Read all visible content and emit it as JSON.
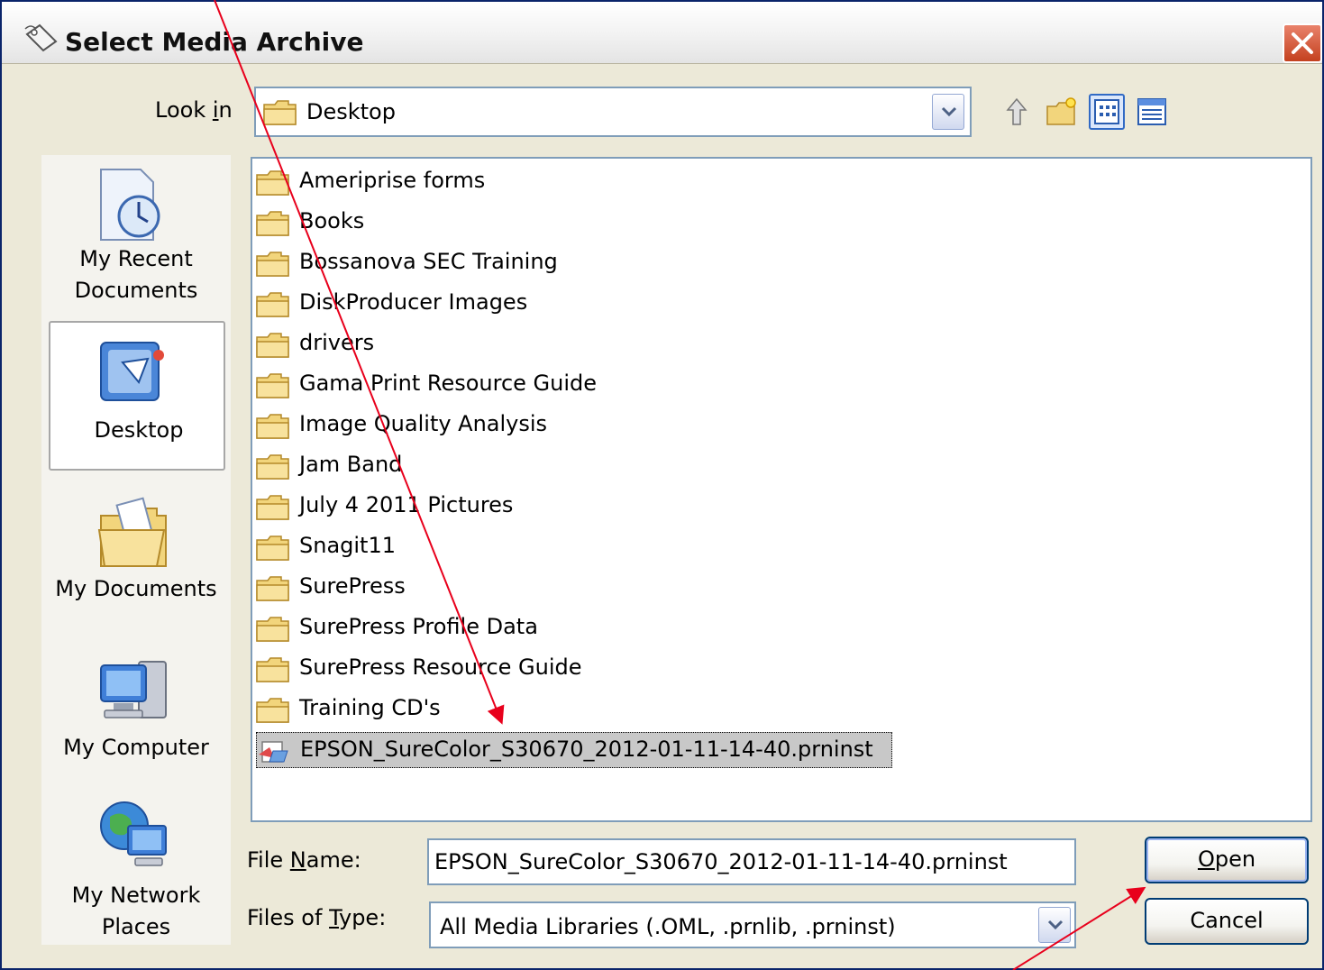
{
  "window": {
    "title": "Select Media Archive"
  },
  "look_in": {
    "label_pre": "Look ",
    "label_accel": "i",
    "label_post": "n",
    "value": "Desktop"
  },
  "places": [
    {
      "label_line1": "My Recent",
      "label_line2": "Documents",
      "icon": "recent-documents-icon"
    },
    {
      "label_line1": "Desktop",
      "label_line2": "",
      "icon": "desktop-icon"
    },
    {
      "label_line1": "My Documents",
      "label_line2": "",
      "icon": "my-documents-icon"
    },
    {
      "label_line1": "My Computer",
      "label_line2": "",
      "icon": "my-computer-icon"
    },
    {
      "label_line1": "My Network",
      "label_line2": "Places",
      "icon": "network-places-icon"
    }
  ],
  "files": [
    {
      "name": "Ameriprise forms",
      "type": "folder"
    },
    {
      "name": "Books",
      "type": "folder"
    },
    {
      "name": "Bossanova SEC Training",
      "type": "folder"
    },
    {
      "name": "DiskProducer Images",
      "type": "folder"
    },
    {
      "name": "drivers",
      "type": "folder"
    },
    {
      "name": "Gama Print Resource Guide",
      "type": "folder"
    },
    {
      "name": "Image Quality Analysis",
      "type": "folder"
    },
    {
      "name": "Jam Band",
      "type": "folder"
    },
    {
      "name": "July 4 2011 Pictures",
      "type": "folder"
    },
    {
      "name": "Snagit11",
      "type": "folder"
    },
    {
      "name": "SurePress",
      "type": "folder"
    },
    {
      "name": "SurePress Profile Data",
      "type": "folder"
    },
    {
      "name": "SurePress Resource Guide",
      "type": "folder"
    },
    {
      "name": "Training CD's",
      "type": "folder"
    },
    {
      "name": "EPSON_SureColor_S30670_2012-01-11-14-40.prninst",
      "type": "file",
      "selected": true
    }
  ],
  "file_name": {
    "label_pre": "File ",
    "label_accel": "N",
    "label_post": "ame:",
    "value": "EPSON_SureColor_S30670_2012-01-11-14-40.prninst"
  },
  "file_type": {
    "label_pre": "Files of ",
    "label_accel": "T",
    "label_post": "ype:",
    "value": "All Media Libraries (.OML, .prnlib, .prninst)"
  },
  "buttons": {
    "open_accel": "O",
    "open_rest": "pen",
    "cancel": "Cancel"
  },
  "colors": {
    "annotation_arrow": "#e8001c",
    "selection": "#c8c8c8",
    "dialog_bg": "#ece9d8"
  }
}
